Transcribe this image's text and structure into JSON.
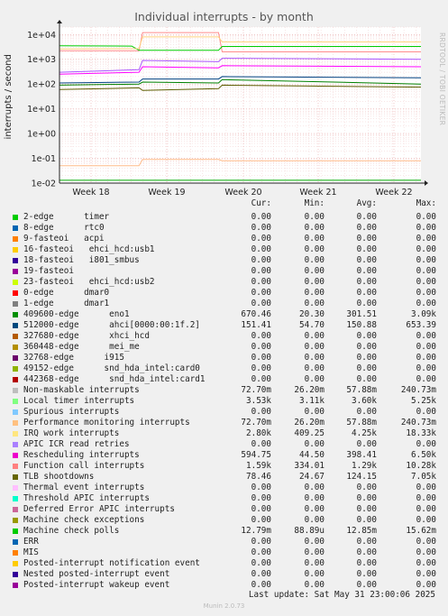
{
  "title": "Individual interrupts - by month",
  "side_label": "RRDTOOL / TOBI OETIKER",
  "ylabel": "interrupts / second",
  "chart_data": {
    "type": "line",
    "title": "Individual interrupts - by month",
    "ylabel": "interrupts / second",
    "yscale": "log",
    "ylim": [
      0.01,
      20000
    ],
    "yticks": [
      "1e-02",
      "1e-01",
      "1e+00",
      "1e+01",
      "1e+02",
      "1e+03",
      "1e+04"
    ],
    "ytick_values": [
      0.01,
      0.1,
      1,
      10,
      100,
      1000,
      10000
    ],
    "xticks": [
      "Week 18",
      "Week 19",
      "Week 20",
      "Week 21",
      "Week 22"
    ],
    "grid": true,
    "series": [
      {
        "name": "Function call interrupts",
        "color": "#ff8c8c",
        "points": [
          [
            0,
            2200
          ],
          [
            0.22,
            2200
          ],
          [
            0.23,
            12000
          ],
          [
            0.44,
            12000
          ],
          [
            0.45,
            2000
          ],
          [
            1,
            2000
          ]
        ]
      },
      {
        "name": "Local timer interrupts",
        "color": "#00cc00",
        "points": [
          [
            0,
            3500
          ],
          [
            0.2,
            3400
          ],
          [
            0.22,
            2300
          ],
          [
            0.44,
            2300
          ],
          [
            0.45,
            3300
          ],
          [
            1,
            3300
          ]
        ]
      },
      {
        "name": "IRQ work interrupts",
        "color": "#ffd27f",
        "points": [
          [
            0,
            2600
          ],
          [
            0.22,
            2700
          ],
          [
            0.23,
            8000
          ],
          [
            0.44,
            8000
          ],
          [
            0.45,
            5000
          ],
          [
            1,
            5000
          ]
        ]
      },
      {
        "name": "Non-maskable interrupts",
        "color": "#aa55ff",
        "points": [
          [
            0,
            300
          ],
          [
            0.22,
            380
          ],
          [
            0.23,
            900
          ],
          [
            0.44,
            800
          ],
          [
            0.45,
            1100
          ],
          [
            1,
            1000
          ]
        ]
      },
      {
        "name": "Rescheduling interrupts",
        "color": "#ff00ff",
        "points": [
          [
            0,
            250
          ],
          [
            0.22,
            300
          ],
          [
            0.23,
            500
          ],
          [
            0.44,
            450
          ],
          [
            0.45,
            550
          ],
          [
            1,
            500
          ]
        ]
      },
      {
        "name": "512000-edge ahci[0000:00:1f.2]",
        "color": "#004080",
        "points": [
          [
            0,
            110
          ],
          [
            0.22,
            120
          ],
          [
            0.23,
            160
          ],
          [
            0.44,
            160
          ],
          [
            0.45,
            200
          ],
          [
            1,
            180
          ]
        ]
      },
      {
        "name": "409600-edge eno1",
        "color": "#008000",
        "points": [
          [
            0,
            90
          ],
          [
            0.22,
            100
          ],
          [
            0.23,
            120
          ],
          [
            0.44,
            110
          ],
          [
            0.45,
            150
          ],
          [
            1,
            100
          ]
        ]
      },
      {
        "name": "TLB shootdowns",
        "color": "#5c5c00",
        "points": [
          [
            0,
            60
          ],
          [
            0.22,
            70
          ],
          [
            0.23,
            55
          ],
          [
            0.44,
            65
          ],
          [
            0.45,
            90
          ],
          [
            1,
            75
          ]
        ]
      },
      {
        "name": "Machine check polls",
        "color": "#00aa00",
        "points": [
          [
            0,
            0.013
          ],
          [
            1,
            0.013
          ]
        ]
      },
      {
        "name": "Performance monitoring interrupts",
        "color": "#ffbb88",
        "points": [
          [
            0,
            0.05
          ],
          [
            0.22,
            0.05
          ],
          [
            0.23,
            0.09
          ],
          [
            0.44,
            0.09
          ],
          [
            0.45,
            0.08
          ],
          [
            1,
            0.08
          ]
        ]
      }
    ]
  },
  "legend": {
    "headers": {
      "cur": "Cur:",
      "min": "Min:",
      "avg": "Avg:",
      "max": "Max:"
    },
    "rows": [
      {
        "color": "#00cc00",
        "name": "2-edge      timer",
        "cur": "0.00",
        "min": "0.00",
        "avg": "0.00",
        "max": "0.00"
      },
      {
        "color": "#0066b3",
        "name": "8-edge      rtc0",
        "cur": "0.00",
        "min": "0.00",
        "avg": "0.00",
        "max": "0.00"
      },
      {
        "color": "#ff8000",
        "name": "9-fasteoi   acpi",
        "cur": "0.00",
        "min": "0.00",
        "avg": "0.00",
        "max": "0.00"
      },
      {
        "color": "#ffcc00",
        "name": "16-fasteoi   ehci_hcd:usb1",
        "cur": "0.00",
        "min": "0.00",
        "avg": "0.00",
        "max": "0.00"
      },
      {
        "color": "#330099",
        "name": "18-fasteoi   i801_smbus",
        "cur": "0.00",
        "min": "0.00",
        "avg": "0.00",
        "max": "0.00"
      },
      {
        "color": "#990099",
        "name": "19-fasteoi",
        "cur": "0.00",
        "min": "0.00",
        "avg": "0.00",
        "max": "0.00"
      },
      {
        "color": "#ccff00",
        "name": "23-fasteoi   ehci_hcd:usb2",
        "cur": "0.00",
        "min": "0.00",
        "avg": "0.00",
        "max": "0.00"
      },
      {
        "color": "#ff0000",
        "name": "0-edge      dmar0",
        "cur": "0.00",
        "min": "0.00",
        "avg": "0.00",
        "max": "0.00"
      },
      {
        "color": "#808080",
        "name": "1-edge      dmar1",
        "cur": "0.00",
        "min": "0.00",
        "avg": "0.00",
        "max": "0.00"
      },
      {
        "color": "#008f00",
        "name": "409600-edge      eno1",
        "cur": "670.46",
        "min": "20.30",
        "avg": "301.51",
        "max": "3.09k"
      },
      {
        "color": "#00487d",
        "name": "512000-edge      ahci[0000:00:1f.2]",
        "cur": "151.41",
        "min": "54.70",
        "avg": "150.88",
        "max": "653.39"
      },
      {
        "color": "#b35a00",
        "name": "327680-edge      xhci_hcd",
        "cur": "0.00",
        "min": "0.00",
        "avg": "0.00",
        "max": "0.00"
      },
      {
        "color": "#b38f00",
        "name": "360448-edge      mei_me",
        "cur": "0.00",
        "min": "0.00",
        "avg": "0.00",
        "max": "0.00"
      },
      {
        "color": "#6b006b",
        "name": "32768-edge      i915",
        "cur": "0.00",
        "min": "0.00",
        "avg": "0.00",
        "max": "0.00"
      },
      {
        "color": "#8fb300",
        "name": "49152-edge      snd_hda_intel:card0",
        "cur": "0.00",
        "min": "0.00",
        "avg": "0.00",
        "max": "0.00"
      },
      {
        "color": "#b30000",
        "name": "442368-edge      snd_hda_intel:card1",
        "cur": "0.00",
        "min": "0.00",
        "avg": "0.00",
        "max": "0.00"
      },
      {
        "color": "#bebebe",
        "name": "Non-maskable interrupts",
        "cur": "72.70m",
        "min": "26.20m",
        "avg": "57.88m",
        "max": "240.73m"
      },
      {
        "color": "#80ff80",
        "name": "Local timer interrupts",
        "cur": "3.53k",
        "min": "3.11k",
        "avg": "3.60k",
        "max": "5.25k"
      },
      {
        "color": "#80c9ff",
        "name": "Spurious interrupts",
        "cur": "0.00",
        "min": "0.00",
        "avg": "0.00",
        "max": "0.00"
      },
      {
        "color": "#ffc080",
        "name": "Performance monitoring interrupts",
        "cur": "72.70m",
        "min": "26.20m",
        "avg": "57.88m",
        "max": "240.73m"
      },
      {
        "color": "#ffe680",
        "name": "IRQ work interrupts",
        "cur": "2.80k",
        "min": "409.25",
        "avg": "4.25k",
        "max": "18.33k"
      },
      {
        "color": "#aa80ff",
        "name": "APIC ICR read retries",
        "cur": "0.00",
        "min": "0.00",
        "avg": "0.00",
        "max": "0.00"
      },
      {
        "color": "#ee00cc",
        "name": "Rescheduling interrupts",
        "cur": "594.75",
        "min": "44.50",
        "avg": "398.41",
        "max": "6.50k"
      },
      {
        "color": "#ff8080",
        "name": "Function call interrupts",
        "cur": "1.59k",
        "min": "334.01",
        "avg": "1.29k",
        "max": "10.28k"
      },
      {
        "color": "#666600",
        "name": "TLB shootdowns",
        "cur": "78.46",
        "min": "24.67",
        "avg": "124.15",
        "max": "7.05k"
      },
      {
        "color": "#ffbfff",
        "name": "Thermal event interrupts",
        "cur": "0.00",
        "min": "0.00",
        "avg": "0.00",
        "max": "0.00"
      },
      {
        "color": "#00ffcc",
        "name": "Threshold APIC interrupts",
        "cur": "0.00",
        "min": "0.00",
        "avg": "0.00",
        "max": "0.00"
      },
      {
        "color": "#cc6699",
        "name": "Deferred Error APIC interrupts",
        "cur": "0.00",
        "min": "0.00",
        "avg": "0.00",
        "max": "0.00"
      },
      {
        "color": "#999900",
        "name": "Machine check exceptions",
        "cur": "0.00",
        "min": "0.00",
        "avg": "0.00",
        "max": "0.00"
      },
      {
        "color": "#00cc00",
        "name": "Machine check polls",
        "cur": "12.79m",
        "min": "88.89u",
        "avg": "12.85m",
        "max": "15.62m"
      },
      {
        "color": "#0066b3",
        "name": "ERR",
        "cur": "0.00",
        "min": "0.00",
        "avg": "0.00",
        "max": "0.00"
      },
      {
        "color": "#ff8000",
        "name": "MIS",
        "cur": "0.00",
        "min": "0.00",
        "avg": "0.00",
        "max": "0.00"
      },
      {
        "color": "#ffcc00",
        "name": "Posted-interrupt notification event",
        "cur": "0.00",
        "min": "0.00",
        "avg": "0.00",
        "max": "0.00"
      },
      {
        "color": "#330099",
        "name": "Nested posted-interrupt event",
        "cur": "0.00",
        "min": "0.00",
        "avg": "0.00",
        "max": "0.00"
      },
      {
        "color": "#990099",
        "name": "Posted-interrupt wakeup event",
        "cur": "0.00",
        "min": "0.00",
        "avg": "0.00",
        "max": "0.00"
      }
    ]
  },
  "last_update": "Last update: Sat May 31 23:00:06 2025",
  "munin_version": "Munin 2.0.73"
}
